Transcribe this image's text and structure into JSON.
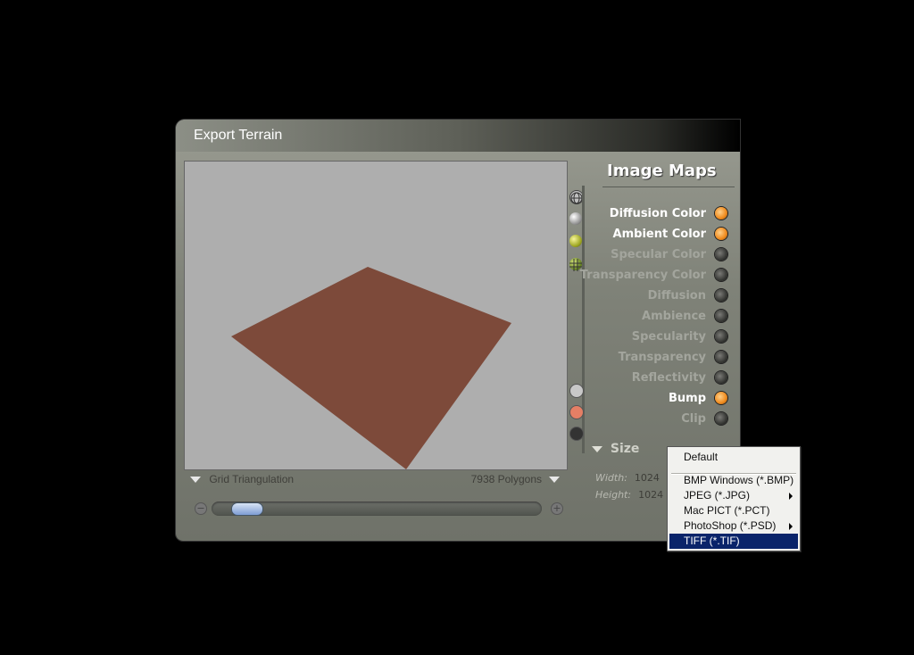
{
  "dialog": {
    "title": "Export Terrain"
  },
  "preview": {
    "triangulation_label": "Grid Triangulation",
    "polygons_label": "7938 Polygons",
    "surface_color": "#7d4a3a"
  },
  "image_maps": {
    "title": "Image Maps",
    "items": [
      {
        "label": "Diffusion Color",
        "enabled": true
      },
      {
        "label": "Ambient Color",
        "enabled": true
      },
      {
        "label": "Specular Color",
        "enabled": false
      },
      {
        "label": "Transparency Color",
        "enabled": false
      },
      {
        "label": "Diffusion",
        "enabled": false
      },
      {
        "label": "Ambience",
        "enabled": false
      },
      {
        "label": "Specularity",
        "enabled": false
      },
      {
        "label": "Transparency",
        "enabled": false
      },
      {
        "label": "Reflectivity",
        "enabled": false
      },
      {
        "label": "Bump",
        "enabled": true
      },
      {
        "label": "Clip",
        "enabled": false
      }
    ]
  },
  "size": {
    "title": "Size",
    "width_label": "Width:",
    "width_value": "1024",
    "height_label": "Height:",
    "height_value": "1024"
  },
  "format_menu": {
    "items": [
      {
        "label": "Default",
        "submenu": false,
        "selected": false
      },
      {
        "label": "BMP Windows (*.BMP)",
        "submenu": false,
        "selected": false
      },
      {
        "label": "JPEG (*.JPG)",
        "submenu": true,
        "selected": false
      },
      {
        "label": "Mac PICT (*.PCT)",
        "submenu": false,
        "selected": false
      },
      {
        "label": "PhotoShop (*.PSD)",
        "submenu": true,
        "selected": false
      },
      {
        "label": "TIFF (*.TIF)",
        "submenu": false,
        "selected": true
      }
    ]
  },
  "icons": {
    "wireframe": "wireframe-sphere-icon",
    "smooth": "smooth-sphere-icon",
    "textured": "textured-sphere-icon",
    "grid": "grid-sphere-icon"
  }
}
